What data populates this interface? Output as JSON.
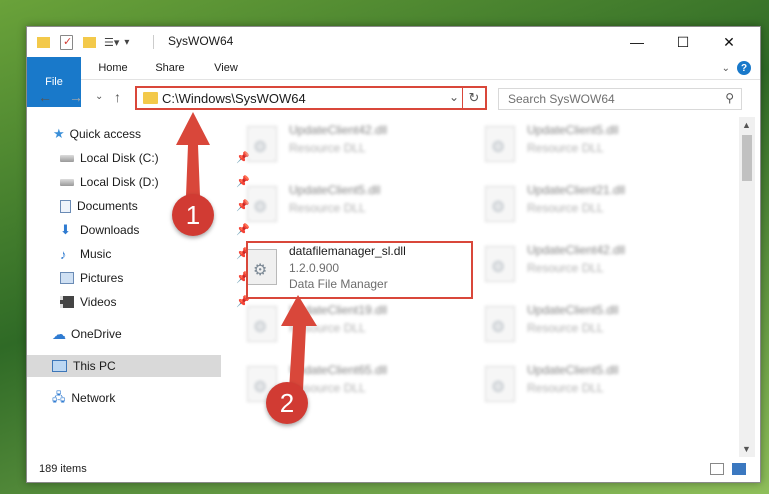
{
  "window": {
    "title": "SysWOW64",
    "controls": {
      "minimize": "—",
      "maximize": "☐",
      "close": "✕"
    }
  },
  "ribbon": {
    "tabs": [
      "File",
      "Home",
      "Share",
      "View"
    ],
    "help": "?"
  },
  "address": {
    "path": "C:\\Windows\\SysWOW64",
    "refresh": "↻",
    "dropdown": "⌄"
  },
  "search": {
    "placeholder": "Search SysWOW64"
  },
  "navigation": {
    "items": [
      {
        "label": "Quick access",
        "icon": "star-icon",
        "pinned": false
      },
      {
        "label": "Local Disk (C:)",
        "icon": "drive-icon",
        "pinned": true
      },
      {
        "label": "Local Disk (D:)",
        "icon": "drive-icon",
        "pinned": true
      },
      {
        "label": "Documents",
        "icon": "document-icon",
        "pinned": true
      },
      {
        "label": "Downloads",
        "icon": "download-icon",
        "pinned": true
      },
      {
        "label": "Music",
        "icon": "music-icon",
        "pinned": true
      },
      {
        "label": "Pictures",
        "icon": "picture-icon",
        "pinned": true
      },
      {
        "label": "Videos",
        "icon": "video-icon",
        "pinned": true
      },
      {
        "label": "OneDrive",
        "icon": "cloud-icon",
        "pinned": false
      },
      {
        "label": "This PC",
        "icon": "computer-icon",
        "pinned": false,
        "selected": true
      },
      {
        "label": "Network",
        "icon": "network-icon",
        "pinned": false
      }
    ]
  },
  "files": [
    {
      "name": "UpdateClient42.dll",
      "desc": "Resource DLL",
      "blurred": true
    },
    {
      "name": "UpdateClient5.dll",
      "desc": "Resource DLL",
      "blurred": true
    },
    {
      "name": "UpdateClient5.dll",
      "desc": "Resource DLL",
      "blurred": true
    },
    {
      "name": "UpdateClient21.dll",
      "desc": "Resource DLL",
      "blurred": true
    },
    {
      "name": "datafilemanager_sl.dll",
      "version": "1.2.0.900",
      "desc": "Data File Manager",
      "blurred": false
    },
    {
      "name": "UpdateClient42.dll",
      "desc": "Resource DLL",
      "blurred": true
    },
    {
      "name": "UpdateClient19.dll",
      "desc": "Resource DLL",
      "blurred": true
    },
    {
      "name": "UpdateClient5.dll",
      "desc": "Resource DLL",
      "blurred": true
    },
    {
      "name": "UpdateClient65.dll",
      "desc": "Resource DLL",
      "blurred": true
    },
    {
      "name": "UpdateClient5.dll",
      "desc": "Resource DLL",
      "blurred": true
    }
  ],
  "status": {
    "count": "189 items"
  },
  "annotations": {
    "step1": "1",
    "step2": "2",
    "color": "#d9473a"
  }
}
